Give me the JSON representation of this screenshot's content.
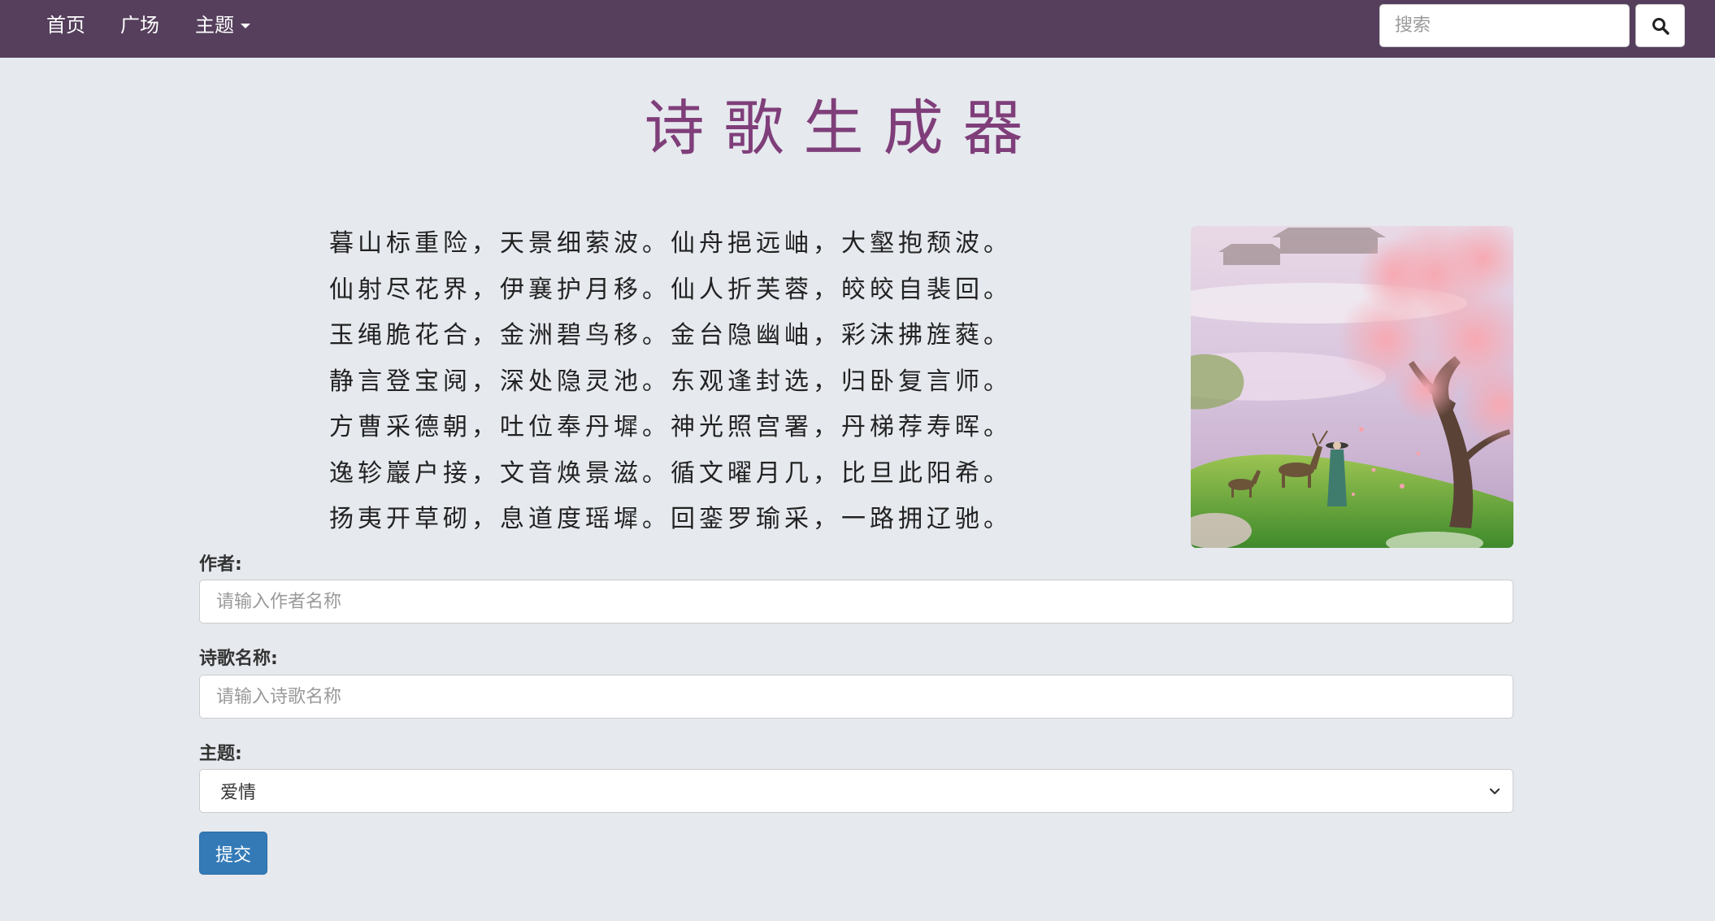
{
  "navbar": {
    "home_label": "首页",
    "square_label": "广场",
    "topic_label": "主题",
    "search_placeholder": "搜索"
  },
  "page": {
    "title": "诗歌生成器"
  },
  "poem": {
    "lines": [
      "暮山标重险，天景细萦波。仙舟挹远岫，大壑抱颓波。",
      "仙射尽花界，伊襄护月移。仙人折芙蓉，皎皎自裴回。",
      "玉绳脆花合，金洲碧鸟移。金台隐幽岫，彩沫拂旌蕤。",
      "静言登宝阋，深处隐灵池。东观逢封选，归卧复言师。",
      "方曹采德朝，吐位奉丹墀。神光照宫署，丹梯荐寿晖。",
      "逸轸巖户接，文音焕景滋。循文曜月几，比旦此阳希。",
      "扬夷开草砌，息道度瑶墀。回銮罗瑜采，一路拥辽驰。"
    ]
  },
  "form": {
    "author_label": "作者:",
    "author_placeholder": "请输入作者名称",
    "title_label": "诗歌名称:",
    "title_placeholder": "请输入诗歌名称",
    "topic_label": "主题:",
    "topic_selected": "爱情",
    "submit_label": "提交"
  },
  "colors": {
    "navbar_bg": "#553f5c",
    "page_bg": "#e6e9ee",
    "title": "#7f3e7a",
    "submit_button": "#337ab7"
  },
  "icons": {
    "search": "search-icon",
    "topic_dropdown": "caret-down-icon",
    "select_arrow": "chevron-down-icon"
  }
}
